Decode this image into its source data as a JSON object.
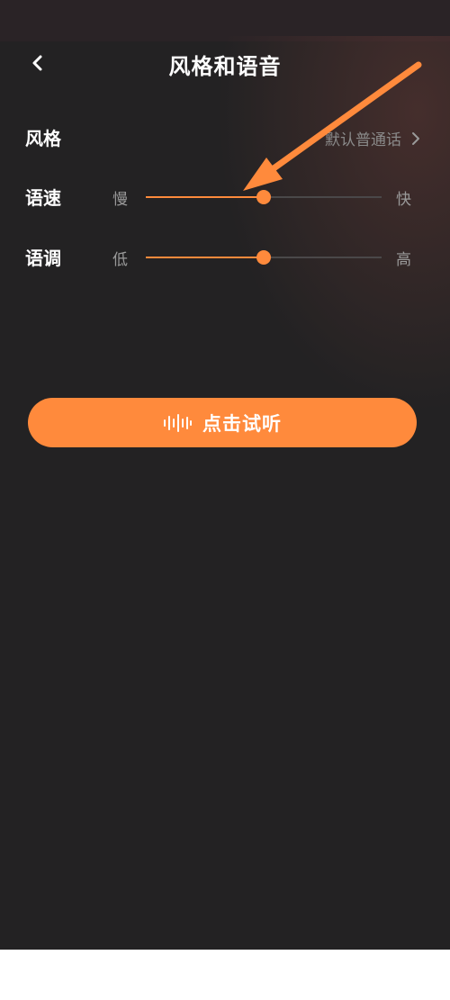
{
  "header": {
    "title": "风格和语音"
  },
  "style_row": {
    "label": "风格",
    "value": "默认普通话"
  },
  "speed_row": {
    "label": "语速",
    "min_label": "慢",
    "max_label": "快",
    "value_percent": 50
  },
  "pitch_row": {
    "label": "语调",
    "min_label": "低",
    "max_label": "高",
    "value_percent": 50
  },
  "play_button": {
    "label": "点击试听"
  },
  "icons": {
    "back": "chevron-left-icon",
    "style_arrow": "chevron-right-icon",
    "play": "waveform-icon"
  },
  "colors": {
    "background": "#232223",
    "accent": "#ff8a3c",
    "muted_text": "#8a8a8a"
  }
}
